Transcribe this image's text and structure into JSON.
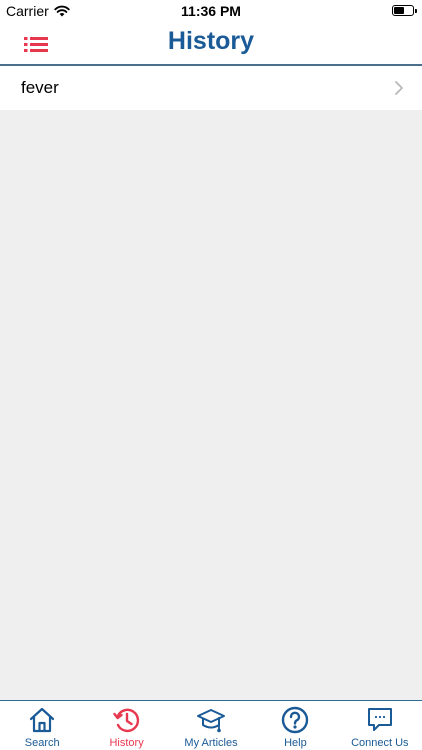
{
  "status_bar": {
    "carrier": "Carrier",
    "time": "11:36 PM",
    "battery_level": 0.6
  },
  "header": {
    "title": "History",
    "menu_icon": "list-menu-icon",
    "accent_color": "#e8384f",
    "title_color": "#1a5a96"
  },
  "history": {
    "items": [
      {
        "label": "fever"
      }
    ]
  },
  "tab_bar": {
    "active_color": "#e8384f",
    "inactive_color": "#1a5a96",
    "tabs": [
      {
        "label": "Search",
        "icon": "home-icon",
        "active": false
      },
      {
        "label": "History",
        "icon": "history-clock-icon",
        "active": true
      },
      {
        "label": "My Articles",
        "icon": "graduation-cap-icon",
        "active": false
      },
      {
        "label": "Help",
        "icon": "question-circle-icon",
        "active": false
      },
      {
        "label": "Connect Us",
        "icon": "chat-bubble-icon",
        "active": false
      }
    ]
  }
}
